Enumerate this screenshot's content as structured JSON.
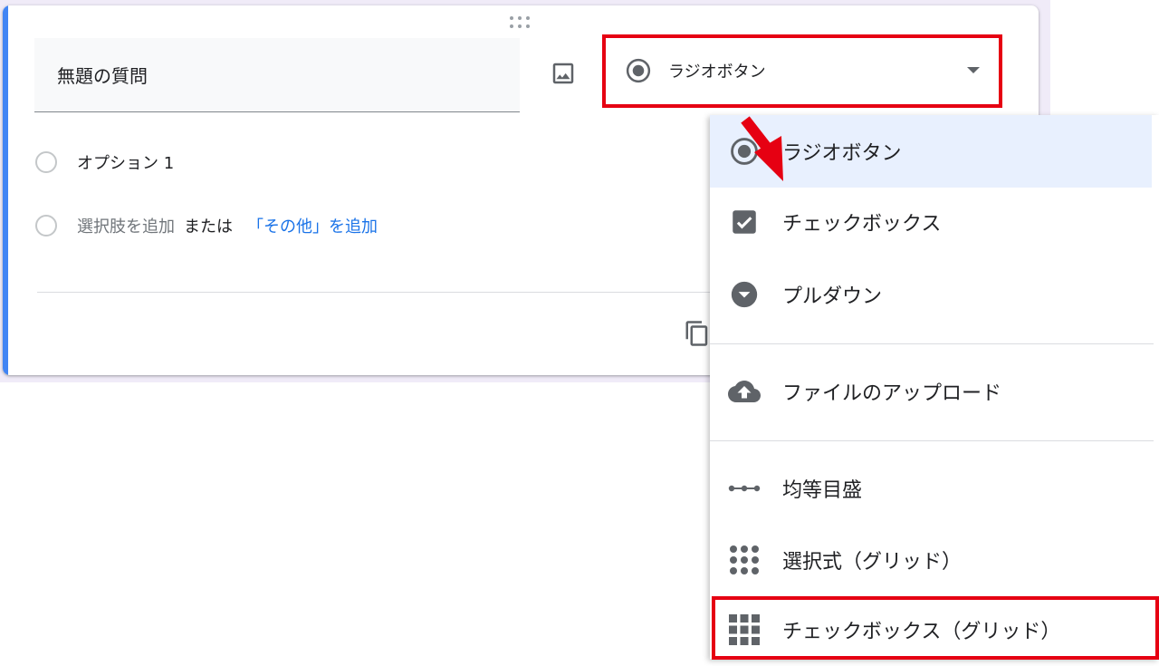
{
  "question": {
    "title": "無題の質問",
    "option1": "オプション 1",
    "add_option": "選択肢を追加",
    "or": "または",
    "add_other": "「その他」を追加"
  },
  "type_select": {
    "selected": "ラジオボタン"
  },
  "menu": {
    "items": [
      {
        "label": "ラジオボタン",
        "icon": "radio-icon"
      },
      {
        "label": "チェックボックス",
        "icon": "checkbox-icon"
      },
      {
        "label": "プルダウン",
        "icon": "dropdown-icon"
      },
      {
        "label": "ファイルのアップロード",
        "icon": "cloud-upload-icon"
      },
      {
        "label": "均等目盛",
        "icon": "linear-scale-icon"
      },
      {
        "label": "選択式（グリッド）",
        "icon": "grid-dots-icon"
      },
      {
        "label": "チェックボックス（グリッド）",
        "icon": "grid-squares-icon"
      }
    ]
  },
  "colors": {
    "accent": "#4285f4",
    "highlight": "#e60012",
    "link": "#1a73e8",
    "selected_bg": "#e8f0fe"
  }
}
